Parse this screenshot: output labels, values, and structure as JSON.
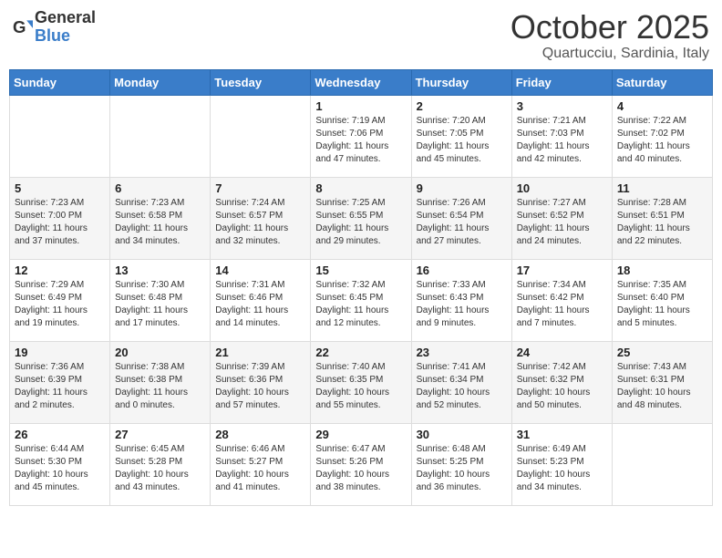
{
  "header": {
    "logo_general": "General",
    "logo_blue": "Blue",
    "month_title": "October 2025",
    "location": "Quartucciu, Sardinia, Italy"
  },
  "weekdays": [
    "Sunday",
    "Monday",
    "Tuesday",
    "Wednesday",
    "Thursday",
    "Friday",
    "Saturday"
  ],
  "weeks": [
    [
      {
        "day": "",
        "info": ""
      },
      {
        "day": "",
        "info": ""
      },
      {
        "day": "",
        "info": ""
      },
      {
        "day": "1",
        "info": "Sunrise: 7:19 AM\nSunset: 7:06 PM\nDaylight: 11 hours\nand 47 minutes."
      },
      {
        "day": "2",
        "info": "Sunrise: 7:20 AM\nSunset: 7:05 PM\nDaylight: 11 hours\nand 45 minutes."
      },
      {
        "day": "3",
        "info": "Sunrise: 7:21 AM\nSunset: 7:03 PM\nDaylight: 11 hours\nand 42 minutes."
      },
      {
        "day": "4",
        "info": "Sunrise: 7:22 AM\nSunset: 7:02 PM\nDaylight: 11 hours\nand 40 minutes."
      }
    ],
    [
      {
        "day": "5",
        "info": "Sunrise: 7:23 AM\nSunset: 7:00 PM\nDaylight: 11 hours\nand 37 minutes."
      },
      {
        "day": "6",
        "info": "Sunrise: 7:23 AM\nSunset: 6:58 PM\nDaylight: 11 hours\nand 34 minutes."
      },
      {
        "day": "7",
        "info": "Sunrise: 7:24 AM\nSunset: 6:57 PM\nDaylight: 11 hours\nand 32 minutes."
      },
      {
        "day": "8",
        "info": "Sunrise: 7:25 AM\nSunset: 6:55 PM\nDaylight: 11 hours\nand 29 minutes."
      },
      {
        "day": "9",
        "info": "Sunrise: 7:26 AM\nSunset: 6:54 PM\nDaylight: 11 hours\nand 27 minutes."
      },
      {
        "day": "10",
        "info": "Sunrise: 7:27 AM\nSunset: 6:52 PM\nDaylight: 11 hours\nand 24 minutes."
      },
      {
        "day": "11",
        "info": "Sunrise: 7:28 AM\nSunset: 6:51 PM\nDaylight: 11 hours\nand 22 minutes."
      }
    ],
    [
      {
        "day": "12",
        "info": "Sunrise: 7:29 AM\nSunset: 6:49 PM\nDaylight: 11 hours\nand 19 minutes."
      },
      {
        "day": "13",
        "info": "Sunrise: 7:30 AM\nSunset: 6:48 PM\nDaylight: 11 hours\nand 17 minutes."
      },
      {
        "day": "14",
        "info": "Sunrise: 7:31 AM\nSunset: 6:46 PM\nDaylight: 11 hours\nand 14 minutes."
      },
      {
        "day": "15",
        "info": "Sunrise: 7:32 AM\nSunset: 6:45 PM\nDaylight: 11 hours\nand 12 minutes."
      },
      {
        "day": "16",
        "info": "Sunrise: 7:33 AM\nSunset: 6:43 PM\nDaylight: 11 hours\nand 9 minutes."
      },
      {
        "day": "17",
        "info": "Sunrise: 7:34 AM\nSunset: 6:42 PM\nDaylight: 11 hours\nand 7 minutes."
      },
      {
        "day": "18",
        "info": "Sunrise: 7:35 AM\nSunset: 6:40 PM\nDaylight: 11 hours\nand 5 minutes."
      }
    ],
    [
      {
        "day": "19",
        "info": "Sunrise: 7:36 AM\nSunset: 6:39 PM\nDaylight: 11 hours\nand 2 minutes."
      },
      {
        "day": "20",
        "info": "Sunrise: 7:38 AM\nSunset: 6:38 PM\nDaylight: 11 hours\nand 0 minutes."
      },
      {
        "day": "21",
        "info": "Sunrise: 7:39 AM\nSunset: 6:36 PM\nDaylight: 10 hours\nand 57 minutes."
      },
      {
        "day": "22",
        "info": "Sunrise: 7:40 AM\nSunset: 6:35 PM\nDaylight: 10 hours\nand 55 minutes."
      },
      {
        "day": "23",
        "info": "Sunrise: 7:41 AM\nSunset: 6:34 PM\nDaylight: 10 hours\nand 52 minutes."
      },
      {
        "day": "24",
        "info": "Sunrise: 7:42 AM\nSunset: 6:32 PM\nDaylight: 10 hours\nand 50 minutes."
      },
      {
        "day": "25",
        "info": "Sunrise: 7:43 AM\nSunset: 6:31 PM\nDaylight: 10 hours\nand 48 minutes."
      }
    ],
    [
      {
        "day": "26",
        "info": "Sunrise: 6:44 AM\nSunset: 5:30 PM\nDaylight: 10 hours\nand 45 minutes."
      },
      {
        "day": "27",
        "info": "Sunrise: 6:45 AM\nSunset: 5:28 PM\nDaylight: 10 hours\nand 43 minutes."
      },
      {
        "day": "28",
        "info": "Sunrise: 6:46 AM\nSunset: 5:27 PM\nDaylight: 10 hours\nand 41 minutes."
      },
      {
        "day": "29",
        "info": "Sunrise: 6:47 AM\nSunset: 5:26 PM\nDaylight: 10 hours\nand 38 minutes."
      },
      {
        "day": "30",
        "info": "Sunrise: 6:48 AM\nSunset: 5:25 PM\nDaylight: 10 hours\nand 36 minutes."
      },
      {
        "day": "31",
        "info": "Sunrise: 6:49 AM\nSunset: 5:23 PM\nDaylight: 10 hours\nand 34 minutes."
      },
      {
        "day": "",
        "info": ""
      }
    ]
  ]
}
